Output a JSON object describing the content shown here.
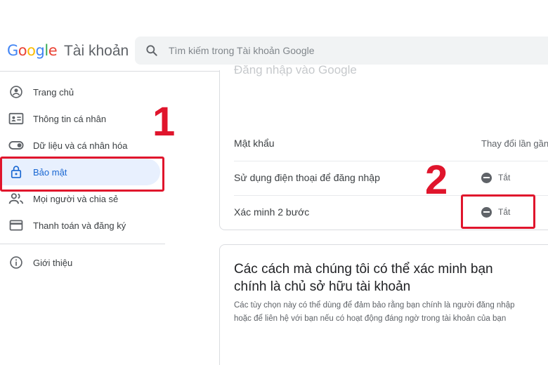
{
  "header": {
    "logo_letters": [
      {
        "char": "G",
        "color": "#4285F4"
      },
      {
        "char": "o",
        "color": "#EA4335"
      },
      {
        "char": "o",
        "color": "#FBBC05"
      },
      {
        "char": "g",
        "color": "#4285F4"
      },
      {
        "char": "l",
        "color": "#34A853"
      },
      {
        "char": "e",
        "color": "#EA4335"
      }
    ],
    "product_name": "Tài khoản",
    "search_placeholder": "Tìm kiếm trong Tài khoản Google"
  },
  "sidebar": {
    "items": [
      {
        "label": "Trang chủ",
        "icon": "account-circle-icon"
      },
      {
        "label": "Thông tin cá nhân",
        "icon": "id-card-icon"
      },
      {
        "label": "Dữ liệu và cá nhân hóa",
        "icon": "toggle-icon"
      },
      {
        "label": "Bảo mật",
        "icon": "lock-icon",
        "active": true
      },
      {
        "label": "Mọi người và chia sẻ",
        "icon": "people-icon"
      },
      {
        "label": "Thanh toán và đăng ký",
        "icon": "credit-card-icon"
      }
    ],
    "footer_item": {
      "label": "Giới thiệu",
      "icon": "info-icon"
    }
  },
  "annotations": {
    "step1": "1",
    "step2": "2",
    "color": "#e0152c"
  },
  "signin_card": {
    "faded_title": "Đăng nhập vào Google",
    "rows": [
      {
        "label": "Mật khẩu",
        "value": "Thay đổi lần gần đây"
      },
      {
        "label": "Sử dụng điện thoại để đăng nhập",
        "value": "Tắt"
      },
      {
        "label": "Xác minh 2 bước",
        "value": "Tắt"
      }
    ]
  },
  "verify_card": {
    "title": "Các cách mà chúng tôi có thể xác minh bạn chính là chủ sở hữu tài khoản",
    "description": "Các tùy chọn này có thể dùng để đảm bảo rằng bạn chính là người đăng nhập hoặc để liên hệ với bạn nếu có hoạt động đáng ngờ trong tài khoản của bạn"
  },
  "colors": {
    "accent": "#1967d2",
    "active_bg": "#e8f0fe",
    "highlight": "#e0152c"
  }
}
